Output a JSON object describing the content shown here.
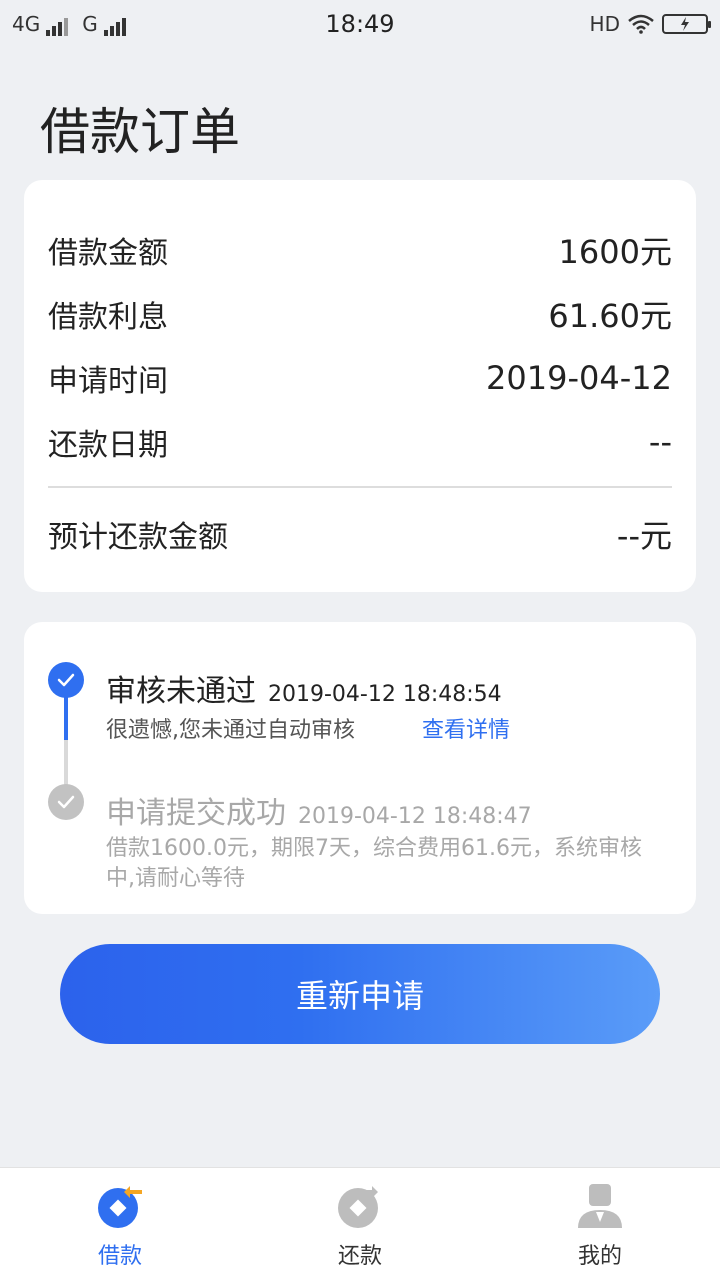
{
  "status_bar": {
    "network_1": "4G",
    "network_2": "G",
    "time": "18:49",
    "hd": "HD"
  },
  "page": {
    "title": "借款订单"
  },
  "summary": {
    "rows": [
      {
        "label": "借款金额",
        "value": "1600元"
      },
      {
        "label": "借款利息",
        "value": "61.60元"
      },
      {
        "label": "申请时间",
        "value": "2019-04-12"
      },
      {
        "label": "还款日期",
        "value": "--"
      }
    ],
    "expected": {
      "label": "预计还款金额",
      "value": "--元"
    }
  },
  "timeline": [
    {
      "title": "审核未通过",
      "time": "2019-04-12 18:48:54",
      "desc": "很遗憾,您未通过自动审核",
      "link": "查看详情",
      "status": "active"
    },
    {
      "title": "申请提交成功",
      "time": "2019-04-12 18:48:47",
      "desc": "借款1600.0元，期限7天，综合费用61.6元，系统审核中,请耐心等待",
      "status": "done"
    }
  ],
  "actions": {
    "reapply": "重新申请"
  },
  "tabs": [
    {
      "label": "借款",
      "icon": "loan-icon",
      "active": true
    },
    {
      "label": "还款",
      "icon": "repay-icon",
      "active": false
    },
    {
      "label": "我的",
      "icon": "profile-icon",
      "active": false
    }
  ],
  "colors": {
    "accent": "#2f6ff0",
    "accent_light": "#5a9cf8",
    "orange": "#f5a623",
    "inactive_gray": "#c2c2c2",
    "background": "#eef0f3"
  }
}
